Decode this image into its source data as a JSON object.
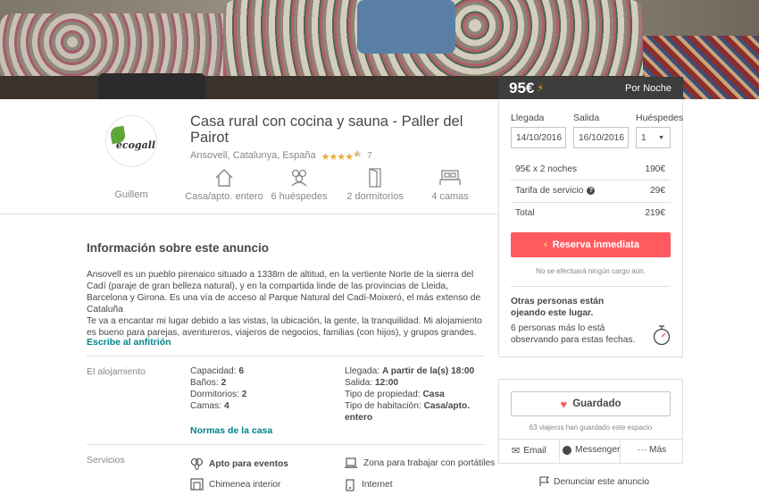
{
  "listing": {
    "price": "95€",
    "per_night": "Por Noche",
    "title": "Casa rural con cocina y sauna - Paller del Pairot",
    "location": "Ansovell, Catalunya, España",
    "rating_stars": 4.5,
    "reviews": "7",
    "host_name": "Guillem",
    "host_logo_text": "ecogall",
    "amenities": [
      {
        "icon": "house-icon",
        "label": "Casa/apto. entero"
      },
      {
        "icon": "guests-icon",
        "label": "6 huéspedes"
      },
      {
        "icon": "door-icon",
        "label": "2 dormitorios"
      },
      {
        "icon": "bed-icon",
        "label": "4 camas"
      }
    ]
  },
  "info": {
    "title": "Información sobre este anuncio",
    "description_1": "Ansovell es un pueblo pirenaico situado a 1338m de altitud, en la vertiente Norte de la sierra del Cadí (paraje de gran belleza natural), y en la compartida linde de las provincias de Lleida, Barcelona y Girona. Es una vía de acceso al Parque Natural del Cadí-Moixeró, el más extenso de Cataluña",
    "description_2": "Te va a encantar mi lugar debido a las vistas, la ubicación, la gente, la tranquilidad. Mi alojamiento es bueno para parejas, aventureros, viajeros de negocios, familias (con hijos), y grupos grandes.",
    "contact_link": "Escribe al anfitrión",
    "space_label": "El alojamiento",
    "capacity_label": "Capacidad:",
    "capacity": "6",
    "baths_label": "Baños:",
    "baths": "2",
    "bedrooms_label": "Dormitorios:",
    "bedrooms": "2",
    "beds_label": "Camas:",
    "beds": "4",
    "checkin_label": "Llegada:",
    "checkin": "A partir de la(s) 18:00",
    "checkout_label": "Salida:",
    "checkout": "12:00",
    "property_type_label": "Tipo de propiedad:",
    "property_type": "Casa",
    "room_type_label": "Tipo de habitación:",
    "room_type": "Casa/apto. entero",
    "house_rules_link": "Normas de la casa",
    "services_label": "Servicios",
    "services": [
      "Apto para eventos",
      "Zona para trabajar con portátiles",
      "Chimenea interior",
      "Internet"
    ]
  },
  "booking": {
    "checkin_label": "Llegada",
    "checkout_label": "Salida",
    "guests_label": "Huéspedes",
    "checkin_value": "14/10/2016",
    "checkout_value": "16/10/2016",
    "guests_value": "1",
    "nights_label": "95€ x 2 noches",
    "nights_total": "190€",
    "service_label": "Tarifa de servicio",
    "service_total": "29€",
    "total_label": "Total",
    "total": "219€",
    "book_button": "Reserva inmediata",
    "no_charge_note": "No se efectuará ningún cargo aún.",
    "others_title": "Otras personas están ojeando este lugar.",
    "others_text": "6 personas más lo está observando para estas fechas."
  },
  "save": {
    "saved_button": "Guardado",
    "saved_count": "63 viajeros han guardado este espacio",
    "email": "Email",
    "messenger": "Messenger",
    "more": "··· Más",
    "report": "Denunciar este anuncio"
  },
  "colors": {
    "accent": "#ff5a5f",
    "link": "#008489",
    "star": "#e8a93a"
  }
}
